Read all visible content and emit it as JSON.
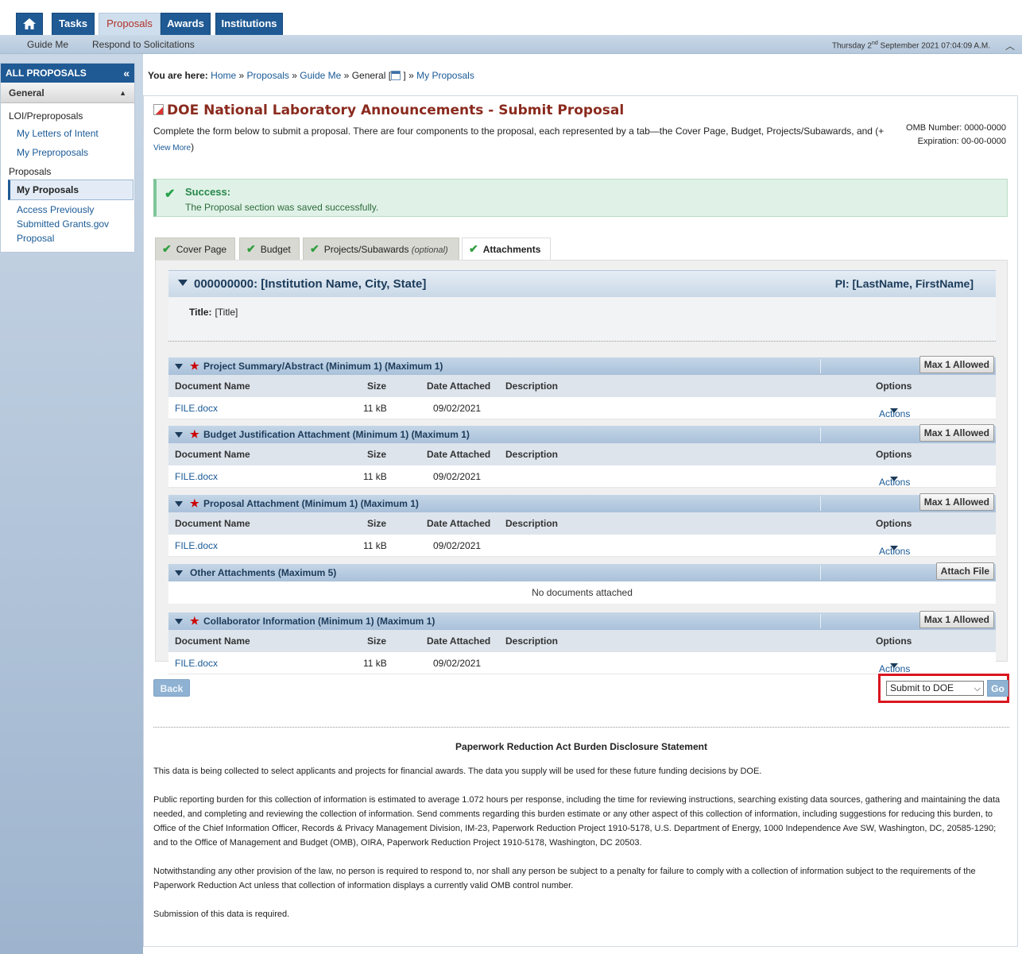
{
  "top_tabs": [
    {
      "label": "Tasks"
    },
    {
      "label": "Proposals"
    },
    {
      "label": "Awards"
    },
    {
      "label": "Institutions"
    }
  ],
  "sub_nav": {
    "guide_me": "Guide Me",
    "respond": "Respond to Solicitations"
  },
  "datetime": {
    "day": "Thursday 2",
    "sup": "nd",
    "rest": " September 2021 07:04:09 A.M."
  },
  "sidebar": {
    "title": "ALL PROPOSALS",
    "section": "General",
    "cat1": "LOI/Preproposals",
    "items1": [
      "My Letters of Intent",
      "My Preproposals"
    ],
    "cat2": "Proposals",
    "selected": "My Proposals",
    "items2": [
      "Access Previously Submitted Grants.gov Proposal"
    ]
  },
  "breadcrumb": {
    "label": "You are here:",
    "home": "Home",
    "proposals": "Proposals",
    "guide": "Guide Me",
    "general": "General [",
    "close": "]",
    "my": "My Proposals",
    "sep": "»"
  },
  "page": {
    "title": "DOE National Laboratory Announcements - Submit Proposal",
    "intro": "Complete the form below to submit a proposal. There are four components to the proposal, each represented by a tab—the Cover Page, Budget, Projects/Subawards, and (+",
    "view_more": "View More",
    "omb_label": "OMB Number:",
    "omb_value": "0000-0000",
    "exp_label": "Expiration:",
    "exp_value": "00-00-0000"
  },
  "success": {
    "title": "Success:",
    "message": "The Proposal section was saved successfully."
  },
  "section_tabs": [
    {
      "label": "Cover Page",
      "note": ""
    },
    {
      "label": "Budget",
      "note": ""
    },
    {
      "label": "Projects/Subawards",
      "note": "(optional)"
    },
    {
      "label": "Attachments",
      "note": ""
    }
  ],
  "institution": {
    "name": "000000000: [Institution Name, City, State]",
    "pi": "PI: [LastName, FirstName]",
    "title_label": "Title:",
    "title_value": "[Title]"
  },
  "columns": {
    "doc": "Document Name",
    "size": "Size",
    "date": "Date Attached",
    "desc": "Description",
    "opts": "Options"
  },
  "sections": [
    {
      "title": "Project Summary/Abstract (Minimum 1) (Maximum 1)",
      "button": "Max 1 Allowed",
      "file": "FILE.docx",
      "size": "11 kB",
      "date": "09/02/2021",
      "action": "Actions"
    },
    {
      "title": "Budget Justification Attachment (Minimum 1) (Maximum 1)",
      "button": "Max 1 Allowed",
      "file": "FILE.docx",
      "size": "11 kB",
      "date": "09/02/2021",
      "action": "Actions"
    },
    {
      "title": "Proposal Attachment (Minimum 1) (Maximum 1)",
      "button": "Max 1 Allowed",
      "file": "FILE.docx",
      "size": "11 kB",
      "date": "09/02/2021",
      "action": "Actions"
    },
    {
      "title": "Other Attachments (Maximum 5)",
      "button": "Attach File",
      "empty": "No documents attached"
    },
    {
      "title": "Collaborator Information (Minimum 1) (Maximum 1)",
      "button": "Max 1 Allowed",
      "file": "FILE.docx",
      "size": "11 kB",
      "date": "09/02/2021",
      "action": "Actions"
    }
  ],
  "controls": {
    "back": "Back",
    "select_value": "Submit to DOE",
    "go": "Go"
  },
  "pra": {
    "title": "Paperwork Reduction Act Burden Disclosure Statement",
    "p1": "This data is being collected to select applicants and projects for financial awards. The data you supply will be used for these future funding decisions by DOE.",
    "p2": "Public reporting burden for this collection of information is estimated to average 1.072 hours per response, including the time for reviewing instructions, searching existing data sources, gathering and maintaining the data needed, and completing and reviewing the collection of information. Send comments regarding this burden estimate or any other aspect of this collection of information, including suggestions for reducing this burden, to Office of the Chief Information Officer, Records & Privacy Management Division, IM-23, Paperwork Reduction Project 1910-5178, U.S. Department of Energy, 1000 Independence Ave SW, Washington, DC, 20585-1290; and to the Office of Management and Budget (OMB), OIRA, Paperwork Reduction Project 1910-5178, Washington, DC 20503.",
    "p3": "Notwithstanding any other provision of the law, no person is required to respond to, nor shall any person be subject to a penalty for failure to comply with a collection of information subject to the requirements of the Paperwork Reduction Act unless that collection of information displays a currently valid OMB control number.",
    "p4": "Submission of this data is required."
  },
  "colors": {
    "nav_blue": "#1f5a94",
    "title_red": "#8a2a1e",
    "success_green": "#27874a",
    "highlight_red": "#d9161f"
  }
}
